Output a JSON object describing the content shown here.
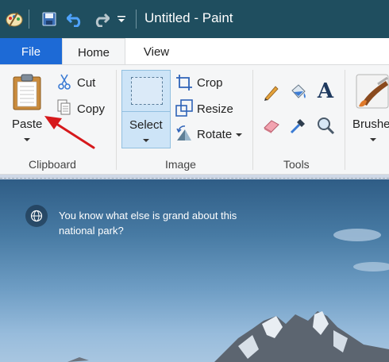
{
  "window": {
    "title": "Untitled - Paint"
  },
  "tabs": [
    {
      "label": "File"
    },
    {
      "label": "Home"
    },
    {
      "label": "View"
    }
  ],
  "clipboard": {
    "paste_label": "Paste",
    "cut_label": "Cut",
    "copy_label": "Copy",
    "group_label": "Clipboard"
  },
  "image": {
    "select_label": "Select",
    "crop_label": "Crop",
    "resize_label": "Resize",
    "rotate_label": "Rotate",
    "group_label": "Image"
  },
  "tools": {
    "group_label": "Tools",
    "text_tool_glyph": "A"
  },
  "brushes": {
    "label": "Brushe"
  },
  "canvas": {
    "caption": "You know what else is grand about this national park?"
  },
  "colors": {
    "titlebar": "#1f4e5f",
    "file_tab": "#1d6ad6",
    "select_active": "#cde4f7",
    "annotation_arrow": "#d6191c"
  }
}
